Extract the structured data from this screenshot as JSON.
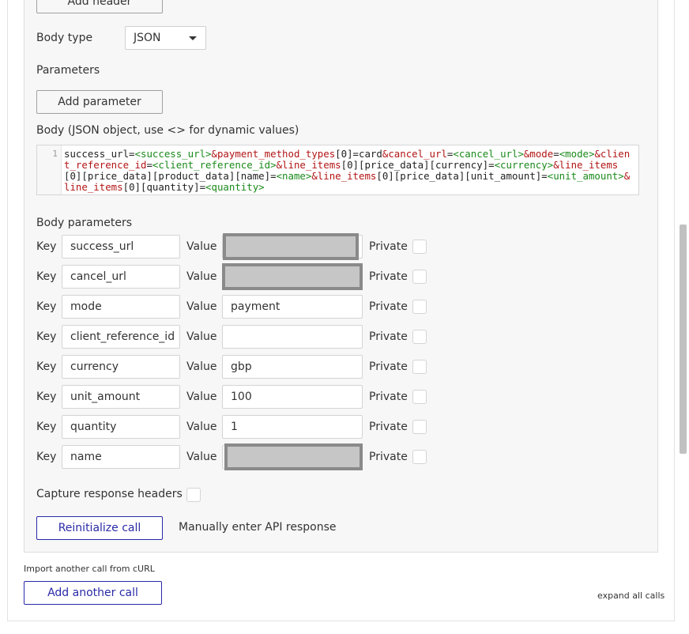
{
  "headers": {
    "add_header_label": "Add header"
  },
  "body_type": {
    "label": "Body type",
    "selected": "JSON"
  },
  "parameters": {
    "label": "Parameters",
    "add_parameter_label": "Add parameter"
  },
  "body": {
    "label": "Body (JSON object, use <> for dynamic values)",
    "line_number": "1",
    "tokens": [
      {
        "t": "t",
        "s": "success_url="
      },
      {
        "t": "v",
        "s": "<success_url>"
      },
      {
        "t": "p",
        "s": "&payment_method_types"
      },
      {
        "t": "t",
        "s": "[0]=card"
      },
      {
        "t": "p",
        "s": "&cancel_url"
      },
      {
        "t": "t",
        "s": "="
      },
      {
        "t": "v",
        "s": "<cancel_url>"
      },
      {
        "t": "p",
        "s": "&mode"
      },
      {
        "t": "t",
        "s": "="
      },
      {
        "t": "v",
        "s": "<mode>"
      },
      {
        "t": "p",
        "s": "&client_reference_id"
      },
      {
        "t": "t",
        "s": "="
      },
      {
        "t": "v",
        "s": "<client_reference_id>"
      },
      {
        "t": "p",
        "s": "&line_items"
      },
      {
        "t": "t",
        "s": "[0][price_data][currency]="
      },
      {
        "t": "v",
        "s": "<currency>"
      },
      {
        "t": "p",
        "s": "&line_items"
      },
      {
        "t": "t",
        "s": "[0][price_data][product_data][name]="
      },
      {
        "t": "v",
        "s": "<name>"
      },
      {
        "t": "p",
        "s": "&line_items"
      },
      {
        "t": "t",
        "s": "[0][price_data][unit_amount]="
      },
      {
        "t": "v",
        "s": "<unit_amount>"
      },
      {
        "t": "p",
        "s": "&line_items"
      },
      {
        "t": "t",
        "s": "[0][quantity]="
      },
      {
        "t": "v",
        "s": "<quantity>"
      }
    ]
  },
  "body_parameters": {
    "label": "Body parameters",
    "key_label": "Key",
    "value_label": "Value",
    "private_label": "Private",
    "rows": [
      {
        "key": "success_url",
        "value": "",
        "redacted": true
      },
      {
        "key": "cancel_url",
        "value": "",
        "redacted": true
      },
      {
        "key": "mode",
        "value": "payment",
        "redacted": false
      },
      {
        "key": "client_reference_id",
        "value": "",
        "redacted": false
      },
      {
        "key": "currency",
        "value": "gbp",
        "redacted": false
      },
      {
        "key": "unit_amount",
        "value": "100",
        "redacted": false
      },
      {
        "key": "quantity",
        "value": "1",
        "redacted": false
      },
      {
        "key": "name",
        "value": "",
        "redacted": true
      }
    ]
  },
  "capture_response_headers": {
    "label": "Capture response headers"
  },
  "actions": {
    "reinitialize_label": "Reinitialize call",
    "manual_label": "Manually enter API response"
  },
  "footer": {
    "import_label": "Import another call from cURL",
    "add_call_label": "Add another call",
    "expand_label": "expand all calls"
  }
}
